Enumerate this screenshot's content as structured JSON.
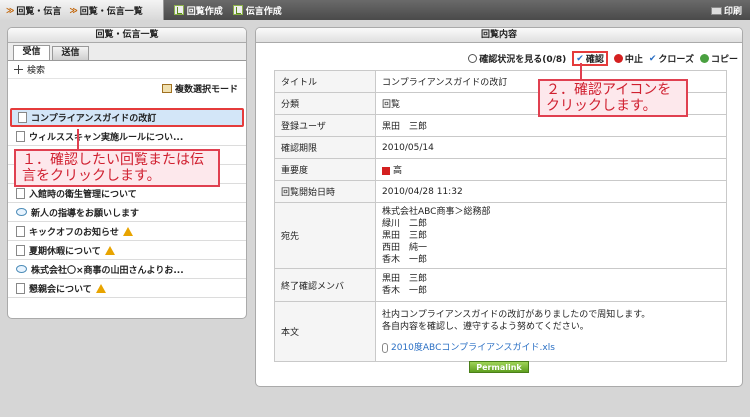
{
  "topbar": {
    "crumb1": "回覧・伝言",
    "crumb2": "回覧・伝言一覧",
    "create_circular": "回覧作成",
    "create_message": "伝言作成",
    "print": "印刷"
  },
  "list_panel": {
    "title": "回覧・伝言一覧",
    "tabs": [
      "受信",
      "送信"
    ],
    "search_label": "検索",
    "multi_select": "複数選択モード",
    "items": [
      {
        "label": "コンプライアンスガイドの改訂",
        "icon": "document-icon",
        "warn": false
      },
      {
        "label": "ウィルススキャン実施ルールについ...",
        "icon": "document-icon",
        "warn": false
      },
      {
        "label": "",
        "icon": "document-icon",
        "warn": false
      },
      {
        "label": "",
        "icon": "document-icon",
        "warn": false
      },
      {
        "label": "入館時の衛生管理について",
        "icon": "document-icon",
        "warn": false
      },
      {
        "label": "新人の指導をお願いします",
        "icon": "message-icon",
        "warn": false
      },
      {
        "label": "キックオフのお知らせ",
        "icon": "document-icon",
        "warn": true
      },
      {
        "label": "夏期休暇について",
        "icon": "document-icon",
        "warn": true
      },
      {
        "label": "株式会社〇×商事の山田さんよりお...",
        "icon": "message-icon",
        "warn": false
      },
      {
        "label": "懇親会について",
        "icon": "document-icon",
        "warn": true
      }
    ]
  },
  "callouts": {
    "step1": "１．確認したい回覧または伝言をクリックします。",
    "step2": "２．確認アイコンをクリックします。"
  },
  "detail_panel": {
    "title": "回覧内容",
    "actions": {
      "view_status": "確認状況を見る(0/8)",
      "confirm": "確認",
      "stop": "中止",
      "close": "クローズ",
      "copy": "コピー"
    },
    "rows": {
      "title_label": "タイトル",
      "title_value": "コンプライアンスガイドの改訂",
      "category_label": "分類",
      "category_value": "回覧",
      "registrant_label": "登録ユーザ",
      "registrant_value": "黒田　三郎",
      "deadline_label": "確認期限",
      "deadline_value": "2010/05/14",
      "importance_label": "重要度",
      "importance_value": "高",
      "start_label": "回覧開始日時",
      "start_value": "2010/04/28 11:32",
      "recipients_label": "宛先",
      "recipients": [
        "株式会社ABC商事＞総務部",
        "緑川　二郎",
        "黒田　三郎",
        "西田　純一",
        "香木　一郎"
      ],
      "confirmed_label": "終了確認メンバ",
      "confirmed": [
        "黒田　三郎",
        "香木　一郎"
      ],
      "body_label": "本文",
      "body_lines": [
        "社内コンプライアンスガイドの改訂がありましたので周知します。",
        "各自内容を確認し、遵守するよう努めてください。"
      ],
      "attachment": "2010度ABCコンプライアンスガイド.xls"
    },
    "permalink": "Permalink"
  }
}
